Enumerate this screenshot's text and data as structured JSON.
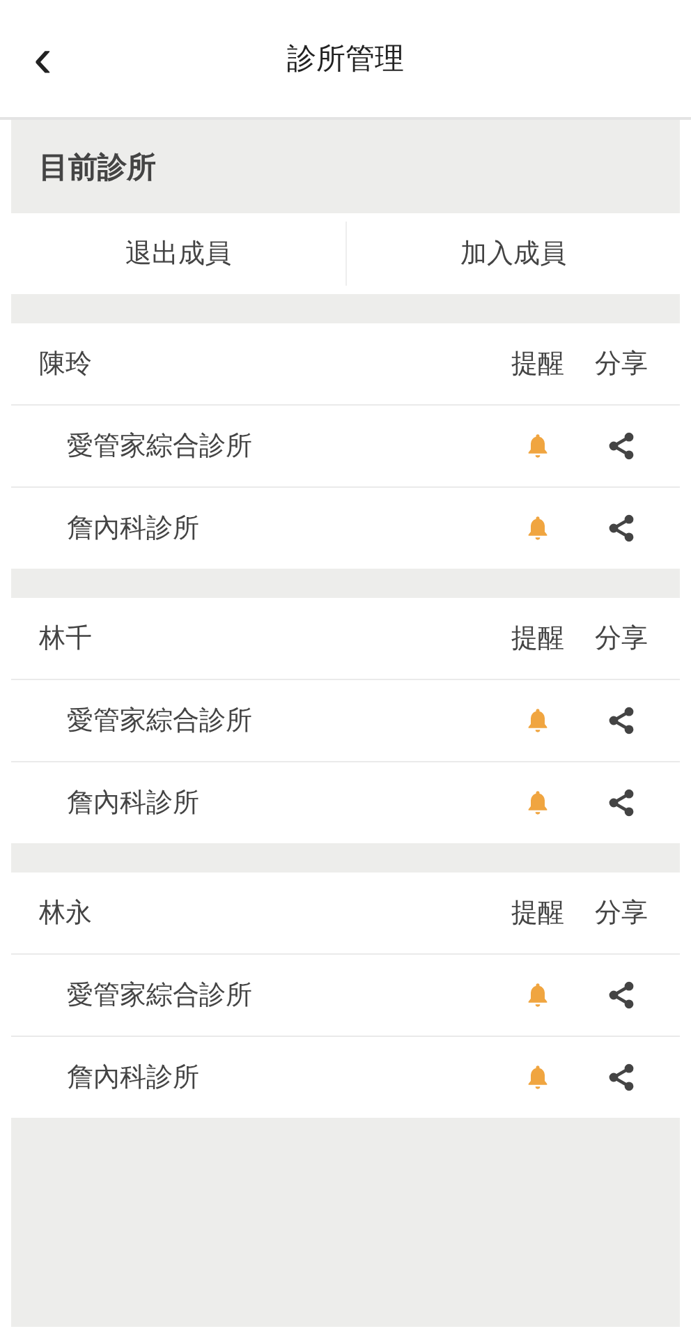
{
  "header": {
    "back": "‹",
    "title": "診所管理"
  },
  "section_title": "目前診所",
  "actions": [
    "退出成員",
    "加入成員"
  ],
  "groups": [
    {
      "name": "陳玲",
      "col_remind": "提醒",
      "col_share": "分享",
      "clinics": [
        "愛管家綜合診所",
        "詹內科診所"
      ]
    },
    {
      "name": "林千",
      "col_remind": "提醒",
      "col_share": "分享",
      "clinics": [
        "愛管家綜合診所",
        "詹內科診所"
      ]
    },
    {
      "name": "林永",
      "col_remind": "提醒",
      "col_share": "分享",
      "clinics": [
        "愛管家綜合診所",
        "詹內科診所"
      ]
    }
  ]
}
